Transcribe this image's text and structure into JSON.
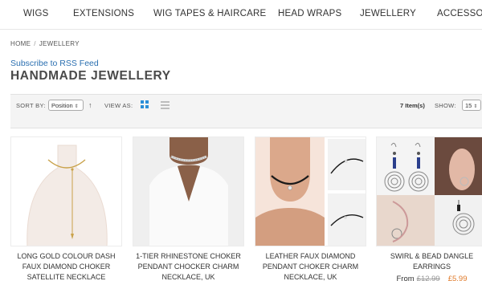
{
  "nav": {
    "items": [
      "WIGS",
      "EXTENSIONS",
      "WIG TAPES & HAIRCARE",
      "HEAD WRAPS",
      "JEWELLERY",
      "ACCESSOR"
    ]
  },
  "breadcrumb": {
    "home": "HOME",
    "sep": "/",
    "current": "JEWELLERY"
  },
  "category": {
    "rss_link": "Subscribe to RSS Feed",
    "title": "HANDMADE JEWELLERY"
  },
  "toolbar": {
    "sort_label": "SORT BY:",
    "sort_value": "Position",
    "view_label": "VIEW AS:",
    "count": "7 Item(s)",
    "show_label": "SHOW:",
    "show_value": "15"
  },
  "products": [
    {
      "name": "LONG GOLD COLOUR DASH FAUX DIAMOND CHOKER SATELLITE NECKLACE"
    },
    {
      "name": "1-TIER RHINESTONE CHOKER PENDANT CHOCKER CHARM NECKLACE, UK"
    },
    {
      "name": "LEATHER FAUX DIAMOND PENDANT CHOKER CHARM NECKLACE, UK"
    },
    {
      "name": "SWIRL & BEAD DANGLE EARRINGS",
      "price_from": "From",
      "old_price": "£12.99",
      "new_price": "£5.99"
    }
  ],
  "colors": {
    "link": "#2a6fb0",
    "accent_grid": "#2a8ed8",
    "sale_price": "#e07a2a"
  }
}
